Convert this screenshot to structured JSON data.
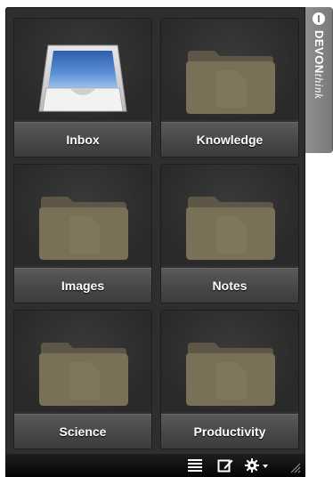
{
  "app": {
    "brand_bold": "DEVON",
    "brand_italic": "think"
  },
  "tiles": [
    {
      "label": "Inbox",
      "icon": "inbox-tray-icon"
    },
    {
      "label": "Knowledge",
      "icon": "folder-icon"
    },
    {
      "label": "Images",
      "icon": "folder-icon"
    },
    {
      "label": "Notes",
      "icon": "folder-icon"
    },
    {
      "label": "Science",
      "icon": "folder-icon"
    },
    {
      "label": "Productivity",
      "icon": "folder-icon"
    }
  ],
  "toolbar": {
    "list_icon": "list-view-icon",
    "edit_icon": "compose-icon",
    "settings_icon": "gear-menu-icon",
    "resize_icon": "resize-grip-icon"
  },
  "colors": {
    "panel": "#2e2e2e",
    "tab": "#858585",
    "folder": "#7a7058",
    "inbox_blue": "#5b8fd3"
  }
}
